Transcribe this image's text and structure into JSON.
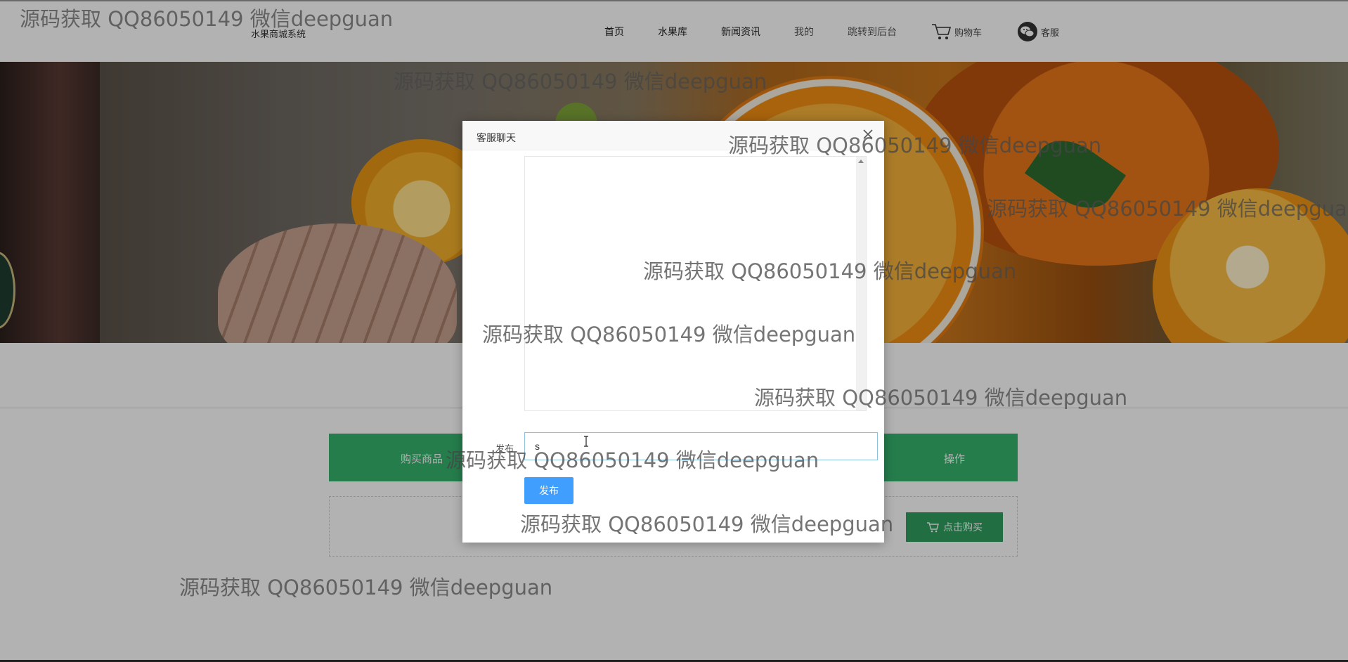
{
  "header": {
    "logo_text": "水果商城系统",
    "nav": [
      {
        "label": "首页"
      },
      {
        "label": "水果库"
      },
      {
        "label": "新闻资讯"
      },
      {
        "label": "我的"
      },
      {
        "label": "跳转到后台"
      }
    ],
    "cart_label": "购物车",
    "service_label": "客服"
  },
  "table": {
    "col_buy": "购买商品",
    "col_op": "操作",
    "buy_button": "点击购买"
  },
  "modal": {
    "title": "客服聊天",
    "post_label": "发布",
    "input_value": "s",
    "submit_label": "发布"
  },
  "watermark": {
    "text": "源码获取 QQ86050149 微信deepguan"
  },
  "colors": {
    "table_header": "#35b36e",
    "buy_button": "#2f9e5e",
    "submit_button": "#409eff"
  }
}
